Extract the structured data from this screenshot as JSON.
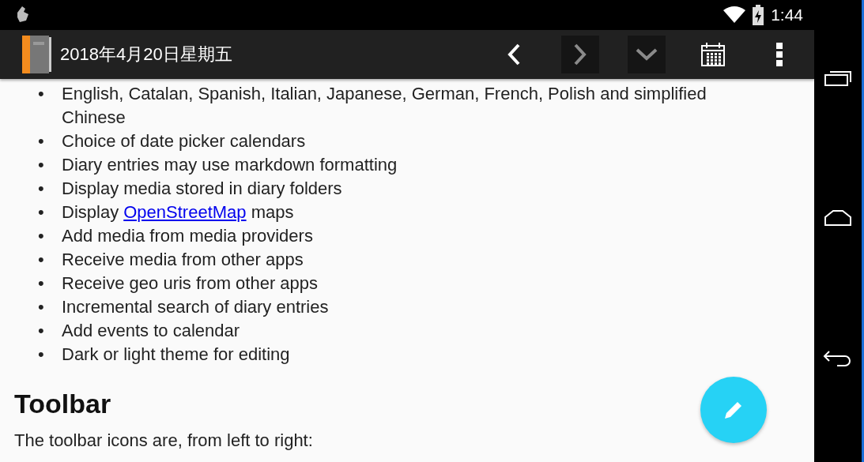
{
  "status_bar": {
    "time": "1:44"
  },
  "toolbar": {
    "title": "2018年4月20日星期五",
    "buttons": [
      {
        "kind": "previous",
        "disabled": false
      },
      {
        "kind": "next",
        "disabled": true
      },
      {
        "kind": "dropdown",
        "disabled": true
      },
      {
        "kind": "calendar",
        "disabled": false
      },
      {
        "kind": "more",
        "disabled": false
      }
    ]
  },
  "content": {
    "features": [
      {
        "bullet": "•",
        "text": "English, Catalan, Spanish, Italian, Japanese, German, French, Polish and simplified Chinese"
      },
      {
        "bullet": "•",
        "text": "Choice of date picker calendars"
      },
      {
        "bullet": "•",
        "text": "Diary entries may use markdown formatting"
      },
      {
        "bullet": "•",
        "text": "Display media stored in diary folders"
      },
      {
        "bullet": "•",
        "text": "Display ",
        "link": "OpenStreetMap",
        "after": " maps"
      },
      {
        "bullet": "•",
        "text": "Add media from media providers"
      },
      {
        "bullet": "•",
        "text": "Receive media from other apps"
      },
      {
        "bullet": "•",
        "text": "Receive geo uris from other apps"
      },
      {
        "bullet": "•",
        "text": "Incremental search of diary entries"
      },
      {
        "bullet": "•",
        "text": "Add events to calendar"
      },
      {
        "bullet": "•",
        "text": "Dark or light theme for editing"
      }
    ],
    "heading": "Toolbar",
    "paragraph": "The toolbar icons are, from left to right:"
  }
}
